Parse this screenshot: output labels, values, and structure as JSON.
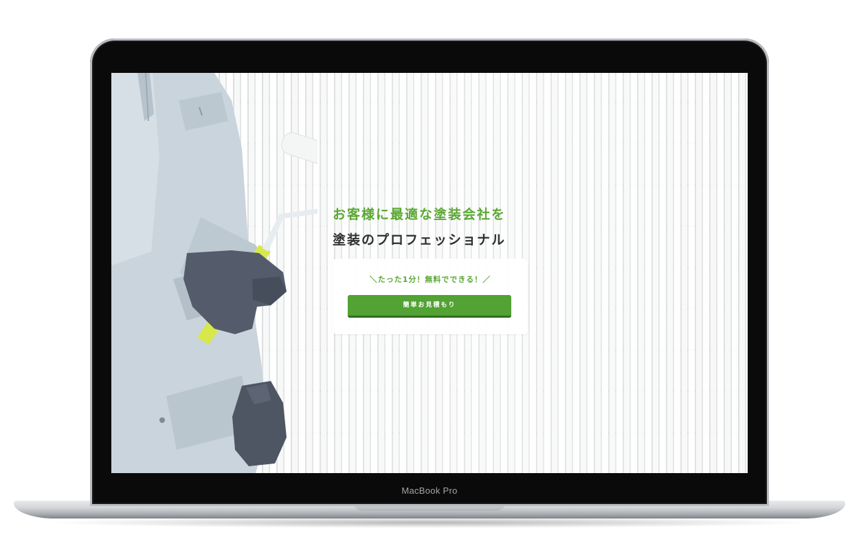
{
  "device": {
    "label": "MacBook Pro"
  },
  "hero": {
    "headline_line1": "お客様に最適な塗装会社を",
    "headline_line2": "塗装のプロフェッショナル",
    "cta_lead": "＼たった1分！無料でできる！／",
    "cta_button_label": "簡単お見積もり"
  },
  "colors": {
    "accent_green": "#5aa832",
    "button_green": "#52a234",
    "button_shadow": "#2f6d1d",
    "heading_dark": "#2f2f2f"
  },
  "icons": {
    "worker": "worker-with-paint-roller-illustration"
  }
}
